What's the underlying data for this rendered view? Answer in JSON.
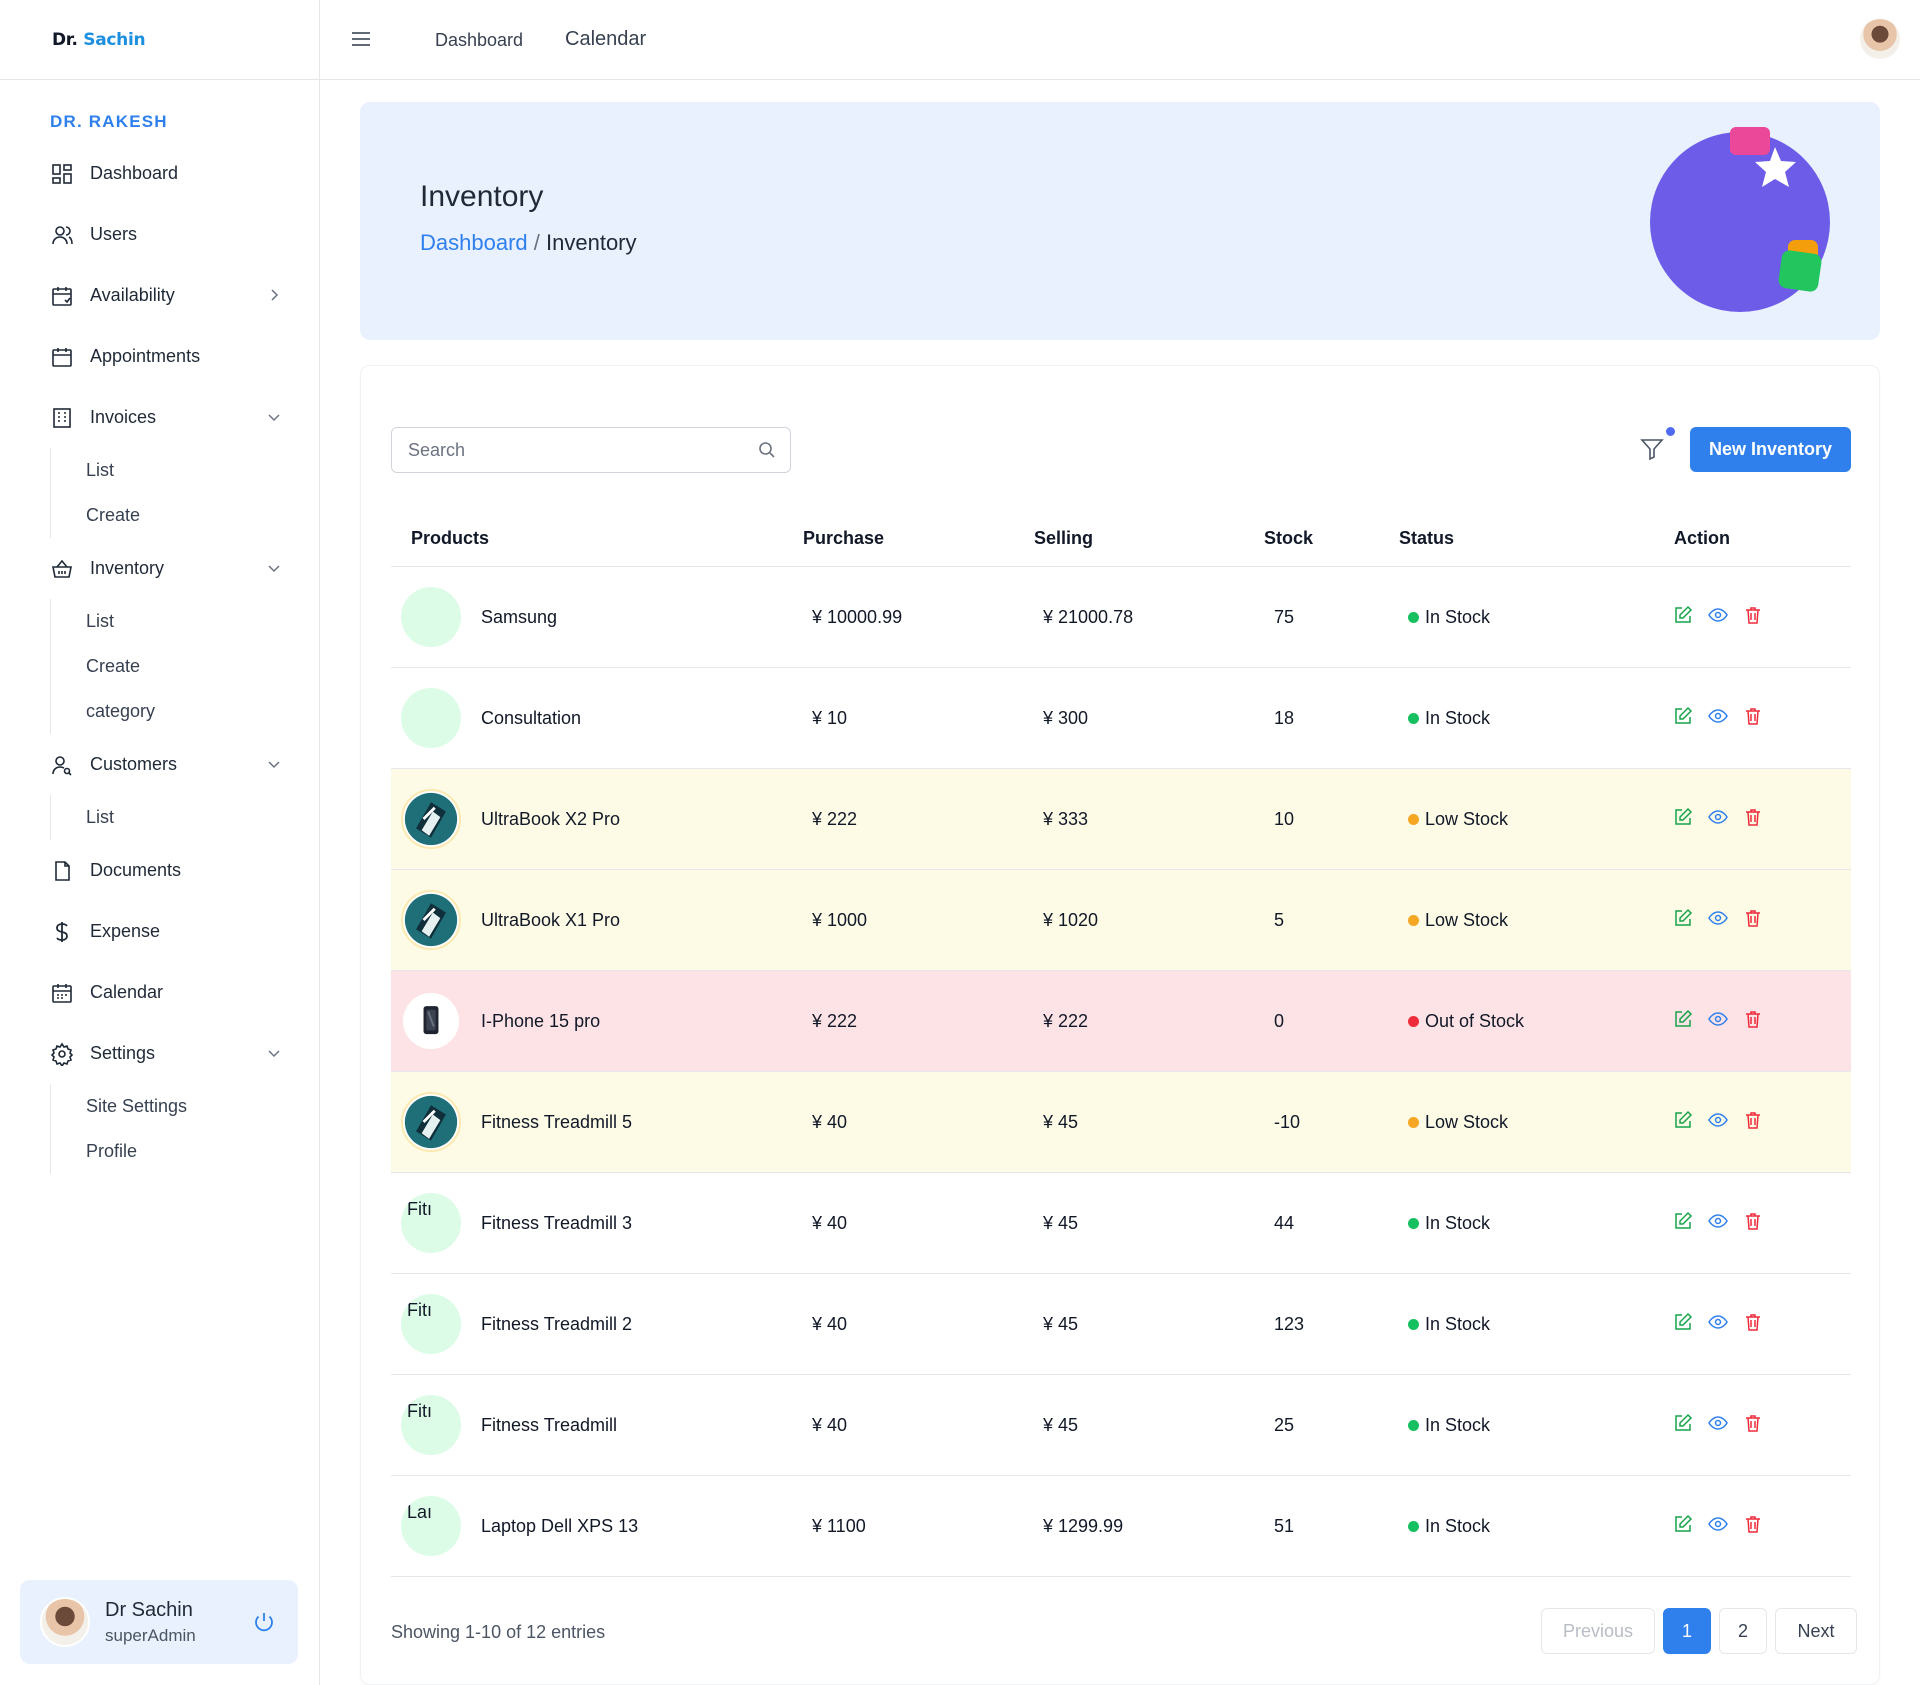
{
  "logo": {
    "part1": "Dr.",
    "part2": "Sachin"
  },
  "sidebar": {
    "section_title": "DR. RAKESH",
    "items": [
      {
        "label": "Dashboard",
        "icon": "dashboard-icon"
      },
      {
        "label": "Users",
        "icon": "user-icon"
      },
      {
        "label": "Availability",
        "icon": "calendar-check-icon",
        "chevron": "right"
      },
      {
        "label": "Appointments",
        "icon": "calendar-icon"
      },
      {
        "label": "Invoices",
        "icon": "building-icon",
        "chevron": "down",
        "sub": [
          "List",
          "Create"
        ]
      },
      {
        "label": "Inventory",
        "icon": "basket-icon",
        "chevron": "down",
        "sub": [
          "List",
          "Create",
          "category"
        ]
      },
      {
        "label": "Customers",
        "icon": "customer-icon",
        "chevron": "down",
        "sub": [
          "List"
        ]
      },
      {
        "label": "Documents",
        "icon": "document-icon"
      },
      {
        "label": "Expense",
        "icon": "dollar-icon"
      },
      {
        "label": "Calendar",
        "icon": "calendar-grid-icon"
      },
      {
        "label": "Settings",
        "icon": "gear-icon",
        "chevron": "down",
        "sub": [
          "Site Settings",
          "Profile"
        ]
      }
    ],
    "user": {
      "name": "Dr Sachin",
      "role": "superAdmin"
    }
  },
  "header": {
    "links": [
      "Dashboard",
      "Calendar"
    ]
  },
  "hero": {
    "title": "Inventory",
    "breadcrumb": {
      "link": "Dashboard",
      "separator": "/",
      "current": "Inventory"
    }
  },
  "toolbar": {
    "search_placeholder": "Search",
    "new_button": "New Inventory"
  },
  "table": {
    "columns": [
      "Products",
      "Purchase",
      "Selling",
      "Stock",
      "Status",
      "Action"
    ],
    "rows": [
      {
        "image": "blank",
        "alt": "",
        "name": "Samsung",
        "purchase": "¥ 10000.99",
        "selling": "¥ 21000.78",
        "stock": "75",
        "status": "In Stock",
        "level": "in"
      },
      {
        "image": "blank",
        "alt": "",
        "name": "Consultation",
        "purchase": "¥ 10",
        "selling": "¥ 300",
        "stock": "18",
        "status": "In Stock",
        "level": "in"
      },
      {
        "image": "tech",
        "alt": "",
        "name": "UltraBook X2 Pro",
        "purchase": "¥ 222",
        "selling": "¥ 333",
        "stock": "10",
        "status": "Low Stock",
        "level": "low"
      },
      {
        "image": "tech",
        "alt": "",
        "name": "UltraBook X1 Pro",
        "purchase": "¥ 1000",
        "selling": "¥ 1020",
        "stock": "5",
        "status": "Low Stock",
        "level": "low"
      },
      {
        "image": "phone",
        "alt": "",
        "name": "I-Phone 15 pro",
        "purchase": "¥ 222",
        "selling": "¥ 222",
        "stock": "0",
        "status": "Out of Stock",
        "level": "out"
      },
      {
        "image": "tech",
        "alt": "",
        "name": "Fitness Treadmill 5",
        "purchase": "¥ 40",
        "selling": "¥ 45",
        "stock": "-10",
        "status": "Low Stock",
        "level": "low"
      },
      {
        "image": "broken",
        "alt": "Fitı",
        "name": "Fitness Treadmill 3",
        "purchase": "¥ 40",
        "selling": "¥ 45",
        "stock": "44",
        "status": "In Stock",
        "level": "in"
      },
      {
        "image": "broken",
        "alt": "Fitı",
        "name": "Fitness Treadmill 2",
        "purchase": "¥ 40",
        "selling": "¥ 45",
        "stock": "123",
        "status": "In Stock",
        "level": "in"
      },
      {
        "image": "broken",
        "alt": "Fitı",
        "name": "Fitness Treadmill",
        "purchase": "¥ 40",
        "selling": "¥ 45",
        "stock": "25",
        "status": "In Stock",
        "level": "in"
      },
      {
        "image": "broken",
        "alt": "Laı",
        "name": "Laptop Dell XPS 13",
        "purchase": "¥ 1100",
        "selling": "¥ 1299.99",
        "stock": "51",
        "status": "In Stock",
        "level": "in"
      }
    ]
  },
  "footer": {
    "showing": "Showing 1-10 of 12 entries",
    "previous": "Previous",
    "pages": [
      "1",
      "2"
    ],
    "next": "Next"
  },
  "colors": {
    "accent": "#2f80ed",
    "in_stock": "#16c060",
    "low_stock": "#f5a623",
    "out_of_stock": "#ef2b3a"
  }
}
